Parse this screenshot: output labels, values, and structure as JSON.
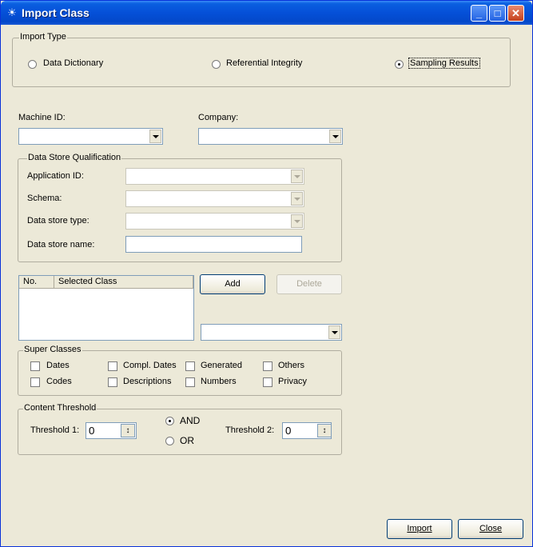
{
  "window": {
    "title": "Import Class",
    "app_icon": "app-icon",
    "minimize_icon": "minimize-icon",
    "maximize_icon": "maximize-icon",
    "close_icon": "close-icon"
  },
  "import_type": {
    "legend": "Import Type",
    "options": [
      "Data Dictionary",
      "Referential Integrity",
      "Sampling Results"
    ],
    "selected": "Sampling Results"
  },
  "machine_id": {
    "label": "Machine ID:",
    "value": ""
  },
  "company": {
    "label": "Company:",
    "value": ""
  },
  "data_store": {
    "legend": "Data Store Qualification",
    "application_id_label": "Application ID:",
    "schema_label": "Schema:",
    "type_label": "Data store type:",
    "name_label": "Data store name:",
    "name_value": ""
  },
  "selected_class_list": {
    "columns": [
      "No.",
      "Selected Class"
    ],
    "rows": []
  },
  "buttons": {
    "add": "Add",
    "delete": "Delete",
    "import": "Import",
    "close": "Close"
  },
  "class_combo": {
    "value": ""
  },
  "super_classes": {
    "legend": "Super Classes",
    "items": [
      "Dates",
      "Compl. Dates",
      "Generated",
      "Others",
      "Codes",
      "Descriptions",
      "Numbers",
      "Privacy"
    ]
  },
  "content_threshold": {
    "legend": "Content Threshold",
    "threshold1_label": "Threshold 1:",
    "threshold1_value": "0",
    "threshold2_label": "Threshold 2:",
    "threshold2_value": "0",
    "and_label": "AND",
    "or_label": "OR",
    "selected": "AND"
  }
}
